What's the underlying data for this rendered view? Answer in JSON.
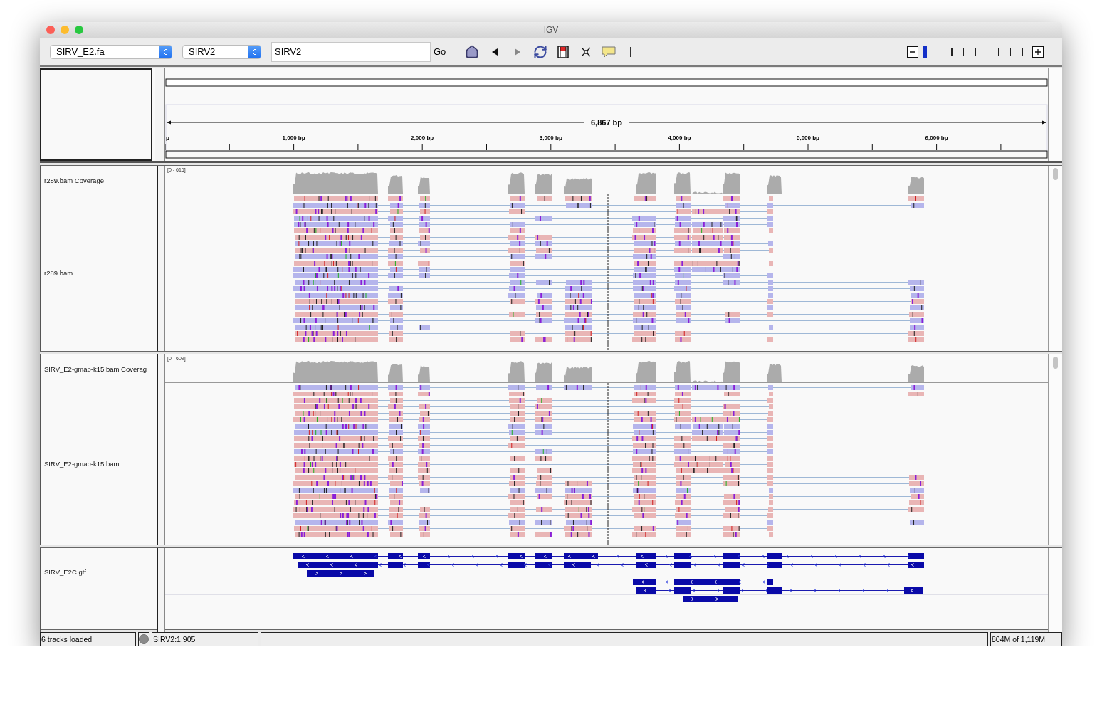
{
  "window": {
    "title": "IGV"
  },
  "toolbar": {
    "genome": "SIRV_E2.fa",
    "chromosome": "SIRV2",
    "locus": "SIRV2",
    "go": "Go",
    "zoom": {
      "level": 0
    }
  },
  "ruler": {
    "span": "6,867 bp",
    "ticks": [
      "p",
      "1,000 bp",
      "2,000 bp",
      "3,000 bp",
      "4,000 bp",
      "5,000 bp",
      "6,000 bp"
    ]
  },
  "panels": [
    {
      "tracks": [
        {
          "kind": "coverage",
          "name": "r289.bam Coverage",
          "range": "[0 - 616]"
        },
        {
          "kind": "alignment",
          "name": "r289.bam"
        }
      ]
    },
    {
      "tracks": [
        {
          "kind": "coverage",
          "name": "SIRV_E2-gmap-k15.bam Coverag",
          "range": "[0 - 609]"
        },
        {
          "kind": "alignment",
          "name": "SIRV_E2-gmap-k15.bam"
        }
      ]
    },
    {
      "tracks": [
        {
          "kind": "annotation",
          "name": "SIRV_E2C.gtf"
        }
      ]
    }
  ],
  "status_bar": {
    "message": "6 tracks loaded",
    "position": "SIRV2:1,905",
    "memory": "804M of 1,119M"
  }
}
